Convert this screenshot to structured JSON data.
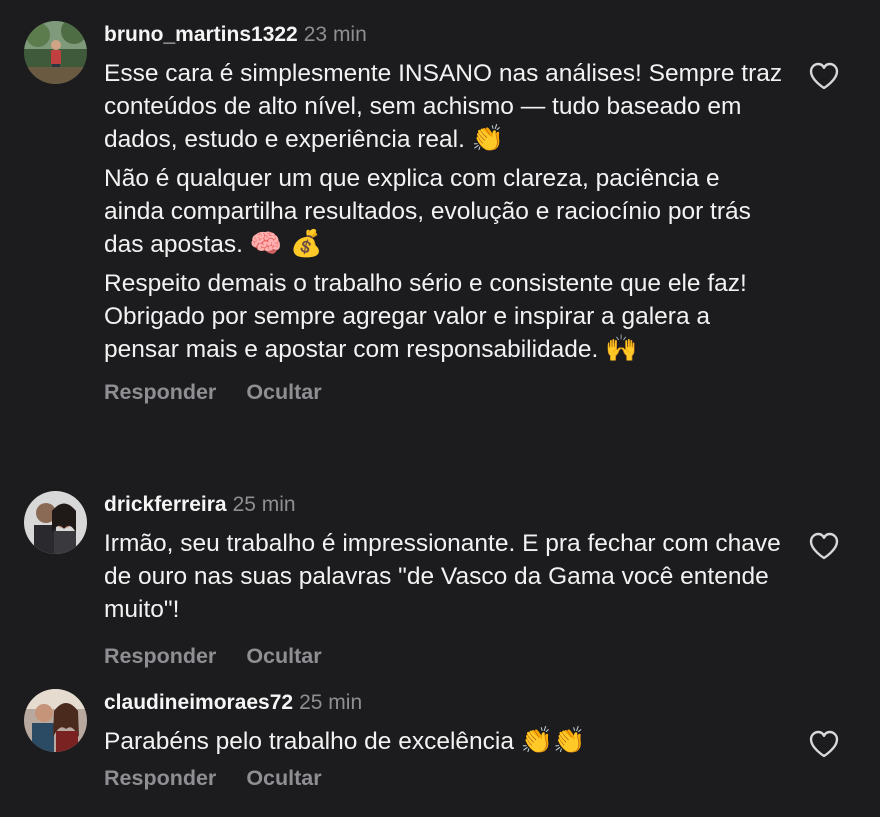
{
  "comments": [
    {
      "username": "bruno_martins1322",
      "time": "23 min",
      "paragraphs": [
        "Esse cara é simplesmente INSANO nas análises! Sempre traz conteúdos de alto nível, sem achismo — tudo baseado em dados, estudo e experiência real.",
        "Não é qualquer um que explica com clareza, paciência e ainda compartilha resultados, evolução e raciocínio por trás das apostas.",
        "Respeito demais o trabalho sério e consistente que ele faz! Obrigado por sempre agregar valor e inspirar a galera a pensar mais e apostar com responsabilidade."
      ],
      "emojis": [
        "👏",
        "🧠 💰",
        "🙌"
      ],
      "reply_label": "Responder",
      "hide_label": "Ocultar",
      "like_icon": "heart-outline-icon"
    },
    {
      "username": "drickferreira",
      "time": "25 min",
      "paragraphs": [
        "Irmão, seu trabalho é impressionante. E pra fechar com chave de ouro nas suas palavras \"de Vasco da Gama você entende muito\"!"
      ],
      "reply_label": "Responder",
      "hide_label": "Ocultar",
      "like_icon": "heart-outline-icon"
    },
    {
      "username": "claudineimoraes72",
      "time": "25 min",
      "paragraphs": [
        "Parabéns pelo trabalho de excelência"
      ],
      "emojis": [
        "👏👏"
      ],
      "reply_label": "Responder",
      "hide_label": "Ocultar",
      "like_icon": "heart-outline-icon"
    }
  ],
  "colors": {
    "background": "#1c1c1e",
    "text": "#f2f2f2",
    "muted": "#8e8e93"
  }
}
